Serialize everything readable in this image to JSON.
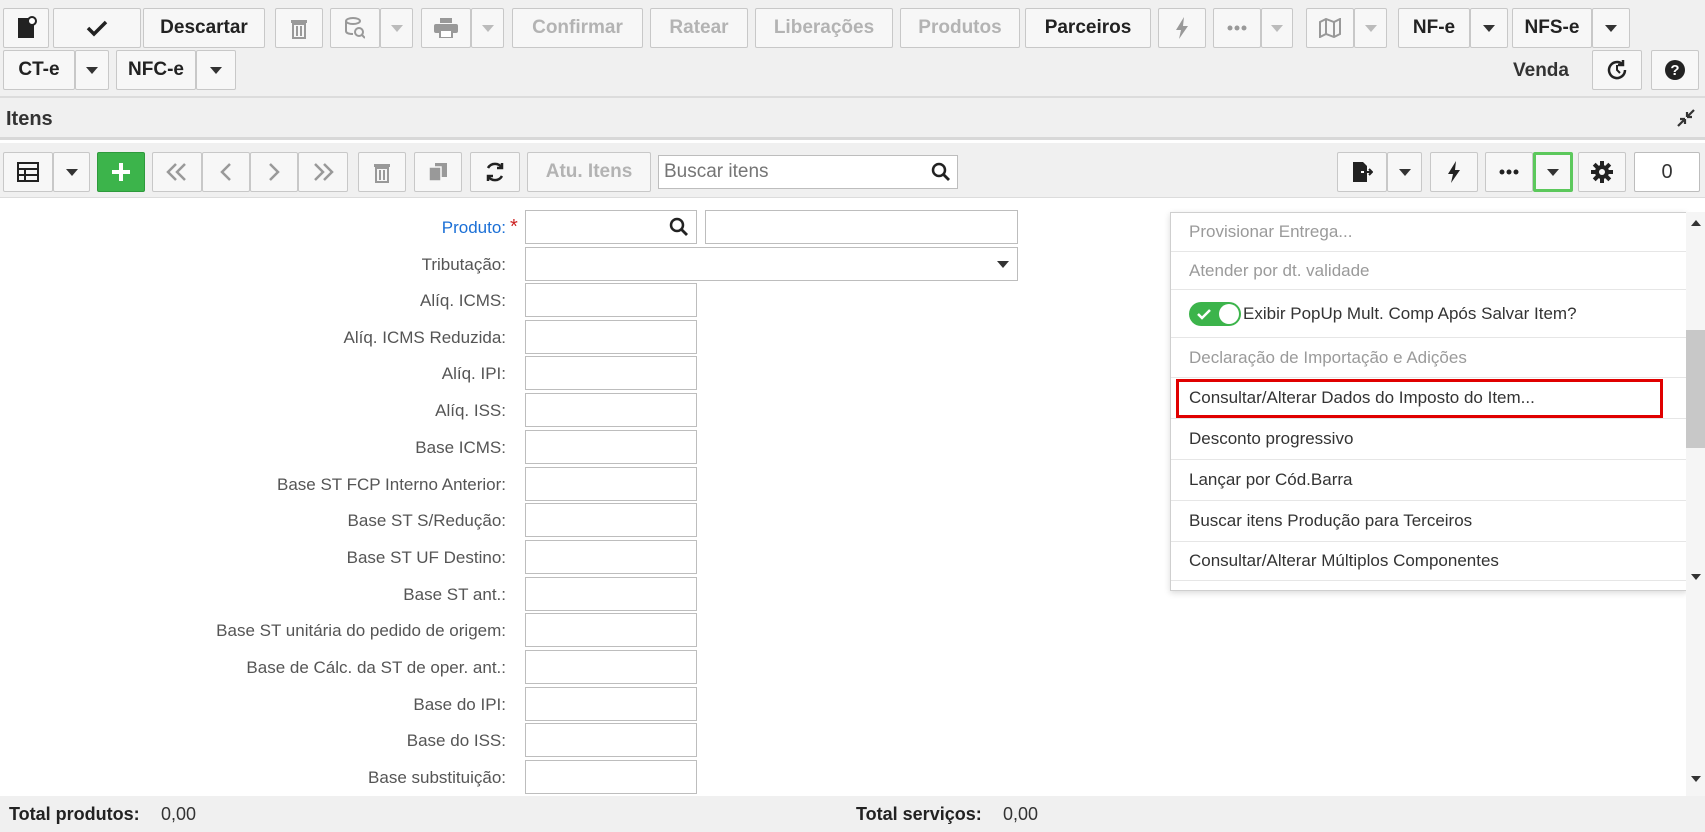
{
  "toolbar": {
    "discard_label": "Descartar",
    "confirm_label": "Confirmar",
    "ratear_label": "Ratear",
    "liberacoes_label": "Liberações",
    "produtos_label": "Produtos",
    "parceiros_label": "Parceiros",
    "nfe_label": "NF-e",
    "nfse_label": "NFS-e",
    "cte_label": "CT-e",
    "nfce_label": "NFC-e",
    "venda_label": "Venda"
  },
  "section": {
    "title": "Itens"
  },
  "items_toolbar": {
    "update_items_label": "Atu. Itens",
    "search_placeholder": "Buscar itens",
    "count_value": "0"
  },
  "form": {
    "produto_label": "Produto:",
    "required_mark": "*",
    "tributacao_label": "Tributação:",
    "fields": [
      {
        "label": "Alíq. ICMS:",
        "value": ""
      },
      {
        "label": "Alíq. ICMS Reduzida:",
        "value": ""
      },
      {
        "label": "Alíq. IPI:",
        "value": ""
      },
      {
        "label": "Alíq. ISS:",
        "value": ""
      },
      {
        "label": "Base ICMS:",
        "value": ""
      },
      {
        "label": "Base ST FCP Interno Anterior:",
        "value": ""
      },
      {
        "label": "Base ST S/Redução:",
        "value": ""
      },
      {
        "label": "Base ST UF Destino:",
        "value": ""
      },
      {
        "label": "Base ST ant.:",
        "value": ""
      },
      {
        "label": "Base ST unitária do pedido de origem:",
        "value": ""
      },
      {
        "label": "Base de Cálc. da ST de oper. ant.:",
        "value": ""
      },
      {
        "label": "Base do IPI:",
        "value": ""
      },
      {
        "label": "Base do ISS:",
        "value": ""
      },
      {
        "label": "Base substituição:",
        "value": ""
      }
    ]
  },
  "dropdown_menu": {
    "items": [
      {
        "label": "Provisionar Entrega...",
        "enabled": false
      },
      {
        "label": "Atender por dt. validade",
        "enabled": false
      },
      {
        "label": "Exibir PopUp Mult. Comp Após Salvar Item?",
        "enabled": true,
        "toggle_on": true
      },
      {
        "label": "Declaração de Importação e Adições",
        "enabled": false
      },
      {
        "label": "Consultar/Alterar Dados do Imposto do Item...",
        "enabled": true,
        "highlighted": true
      },
      {
        "label": "Desconto progressivo",
        "enabled": true
      },
      {
        "label": "Lançar por Cód.Barra",
        "enabled": true
      },
      {
        "label": "Buscar itens Produção para Terceiros",
        "enabled": true
      },
      {
        "label": "Consultar/Alterar Múltiplos Componentes",
        "enabled": true
      }
    ]
  },
  "footer": {
    "total_produtos_label": "Total produtos:",
    "total_produtos_value": "0,00",
    "total_servicos_label": "Total serviços:",
    "total_servicos_value": "0,00"
  },
  "colors": {
    "add_button": "#3cb44b",
    "highlight_border": "#e00000",
    "active_button_border": "#5cc85c",
    "toggle_on": "#3cb44b",
    "link_blue": "#1a6fd6"
  }
}
